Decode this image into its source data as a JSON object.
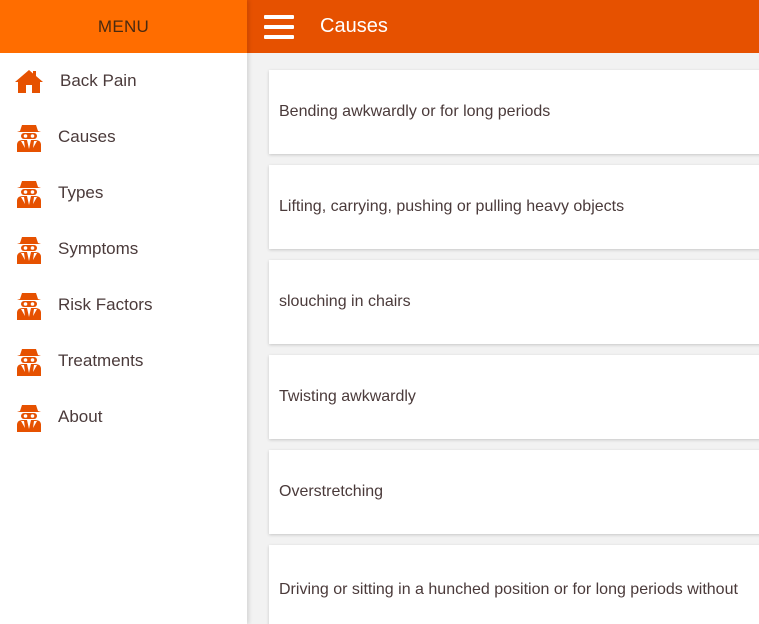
{
  "sidebar": {
    "header": "MENU",
    "items": [
      {
        "label": "Back Pain",
        "icon": "home-icon"
      },
      {
        "label": "Causes",
        "icon": "spy-icon"
      },
      {
        "label": "Types",
        "icon": "spy-icon"
      },
      {
        "label": "Symptoms",
        "icon": "spy-icon"
      },
      {
        "label": "Risk Factors",
        "icon": "spy-icon"
      },
      {
        "label": "Treatments",
        "icon": "spy-icon"
      },
      {
        "label": "About",
        "icon": "spy-icon"
      }
    ]
  },
  "appbar": {
    "title": "Causes",
    "menu_icon": "hamburger-icon"
  },
  "causes": [
    "Bending awkwardly or for long periods",
    "Lifting, carrying, pushing or pulling heavy objects",
    "slouching in chairs",
    "Twisting awkwardly",
    "Overstretching",
    "Driving or sitting in a hunched position or for long periods without"
  ],
  "colors": {
    "sidebar_header": "#ff6d00",
    "appbar": "#e65100",
    "icon": "#e65100"
  }
}
